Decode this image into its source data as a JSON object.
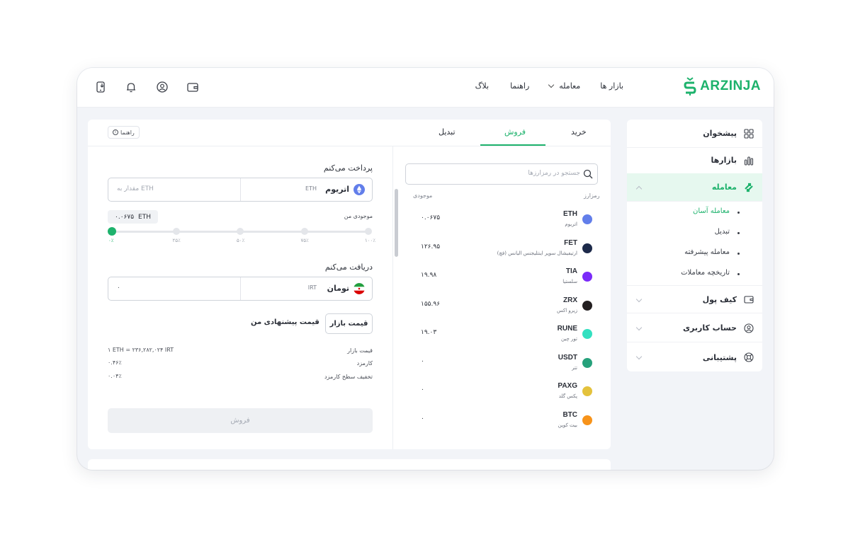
{
  "brand": {
    "name": "ARZINJA",
    "color": "#1db26c"
  },
  "topnav": {
    "markets": "بازار ها",
    "trade": "معامله",
    "guide": "راهنما",
    "blog": "بلاگ"
  },
  "topicons": [
    "wallet-icon",
    "user-circle-icon",
    "bell-icon",
    "mobile-download-icon"
  ],
  "sidebar": {
    "dashboard": "پیشخوان",
    "markets": "بازارها",
    "trade": "معامله",
    "trade_sub": [
      "معامله آسان",
      "تبدیل",
      "معامله پیشرفته",
      "تاریخچه معاملات"
    ],
    "wallet": "کیف پول",
    "account": "حساب کاربری",
    "support": "پشتیبانی"
  },
  "tabs": {
    "buy": "خرید",
    "sell": "فروش",
    "convert": "تبدیل",
    "help": "راهنما",
    "active": "sell"
  },
  "market_list": {
    "search_placeholder": "جستجو در رمزارزها",
    "col_coin": "رمزارز",
    "col_balance": "موجودی",
    "rows": [
      {
        "symbol": "ETH",
        "name": "اتریوم",
        "balance": "۰.۰۶۷۵",
        "color": "#627eea"
      },
      {
        "symbol": "FET",
        "name": "ارتیفیشال سوپر اینتلیجنس الیانس (فچ)",
        "balance": "۱۲۶.۹۵",
        "color": "#1d2a4a"
      },
      {
        "symbol": "TIA",
        "name": "سلستیا",
        "balance": "۱۹.۹۸",
        "color": "#7b2bf9"
      },
      {
        "symbol": "ZRX",
        "name": "زیرو اکس",
        "balance": "۱۵۵.۹۶",
        "color": "#231f20"
      },
      {
        "symbol": "RUNE",
        "name": "تور چین",
        "balance": "۱۹.۰۳",
        "color": "#33e0c0"
      },
      {
        "symbol": "USDT",
        "name": "تتر",
        "balance": "۰",
        "color": "#26a17b"
      },
      {
        "symbol": "PAXG",
        "name": "پکس گلد",
        "balance": "۰",
        "color": "#e4c23c"
      },
      {
        "symbol": "BTC",
        "name": "بیت کوین",
        "balance": "۰",
        "color": "#f7931a"
      }
    ]
  },
  "trade": {
    "pay_label": "پرداخت می‌کنم",
    "pay_coin": "اتریوم",
    "pay_code": "ETH",
    "pay_placeholder": "مقدار به ETH",
    "balance_label": "موجودی من",
    "balance_value": "۰.۰۶۷۵",
    "balance_unit": "ETH",
    "slider_ticks": [
      "۰٪",
      "۲۵٪",
      "۵۰٪",
      "۷۵٪",
      "۱۰۰٪"
    ],
    "slider_value": 0,
    "receive_label": "دریافت می‌کنم",
    "receive_coin": "تومان",
    "receive_code": "IRT",
    "receive_value": "۰",
    "market_price_btn": "قیمت بازار",
    "offer_price": "قیمت پیشنهادی من",
    "info": [
      {
        "label": "قیمت بازار",
        "value": "۱ ETH = ۲۳۶,۲۸۲,۰۲۴ IRT"
      },
      {
        "label": "کارمزد",
        "value": "۰.۴۶٪"
      },
      {
        "label": "تخفیف سطح کارمزد",
        "value": "۰.۰۴٪"
      }
    ],
    "sell_btn": "فروش"
  }
}
